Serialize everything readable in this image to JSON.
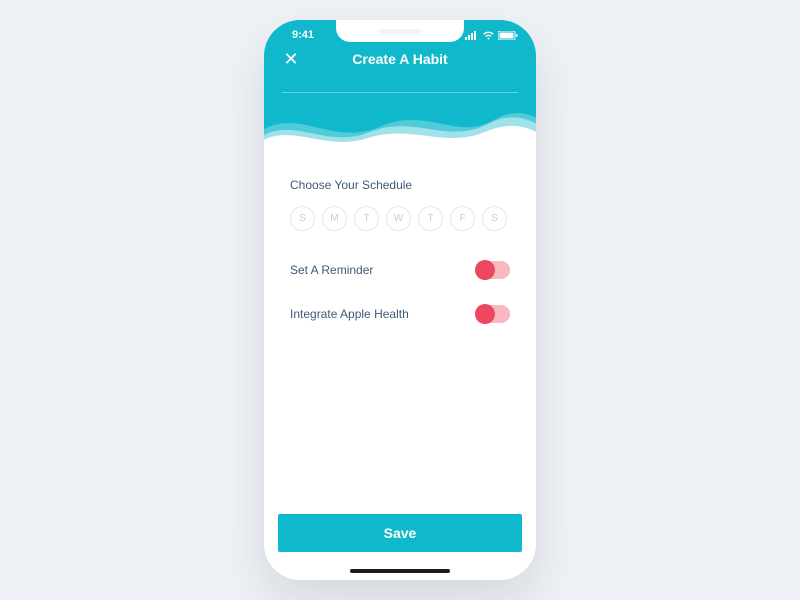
{
  "status": {
    "time": "9:41"
  },
  "header": {
    "title": "Create A Habit"
  },
  "schedule": {
    "label": "Choose Your Schedule",
    "days": [
      "S",
      "M",
      "T",
      "W",
      "T",
      "F",
      "S"
    ]
  },
  "options": {
    "reminder_label": "Set A Reminder",
    "health_label": "Integrate Apple Health"
  },
  "actions": {
    "save": "Save"
  },
  "colors": {
    "accent": "#10b8cb",
    "toggle_on": "#ed4760"
  }
}
